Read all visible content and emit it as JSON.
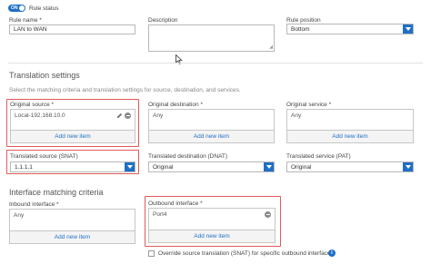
{
  "rule_status": {
    "toggle": "ON",
    "label": "Rule status"
  },
  "rule_name": {
    "label": "Rule name *",
    "value": "LAN to WAN"
  },
  "description": {
    "label": "Description",
    "value": ""
  },
  "rule_position": {
    "label": "Rule position",
    "value": "Bottom"
  },
  "translation": {
    "title": "Translation settings",
    "subtitle": "Select the matching criteria and translation settings for source, destination, and services.",
    "original_source": {
      "label": "Original source *",
      "item": "Local-192.168.10.0",
      "add": "Add new item"
    },
    "original_destination": {
      "label": "Original destination *",
      "item": "Any",
      "add": "Add new item"
    },
    "original_service": {
      "label": "Original service *",
      "item": "Any",
      "add": "Add new item"
    },
    "translated_source": {
      "label": "Translated source (SNAT)",
      "value": "1.1.1.1"
    },
    "translated_destination": {
      "label": "Translated destination (DNAT)",
      "value": "Original"
    },
    "translated_service": {
      "label": "Translated service (PAT)",
      "value": "Original"
    }
  },
  "interface": {
    "title": "Interface matching criteria",
    "inbound": {
      "label": "Inbound interface *",
      "item": "Any",
      "add": "Add new item"
    },
    "outbound": {
      "label": "Outbound interface *",
      "item": "Port4",
      "add": "Add new item"
    },
    "override_label": "Override source translation (SNAT) for specific outbound interfaces"
  },
  "colors": {
    "accent": "#1f6fc6",
    "highlight": "#e05a5a"
  }
}
